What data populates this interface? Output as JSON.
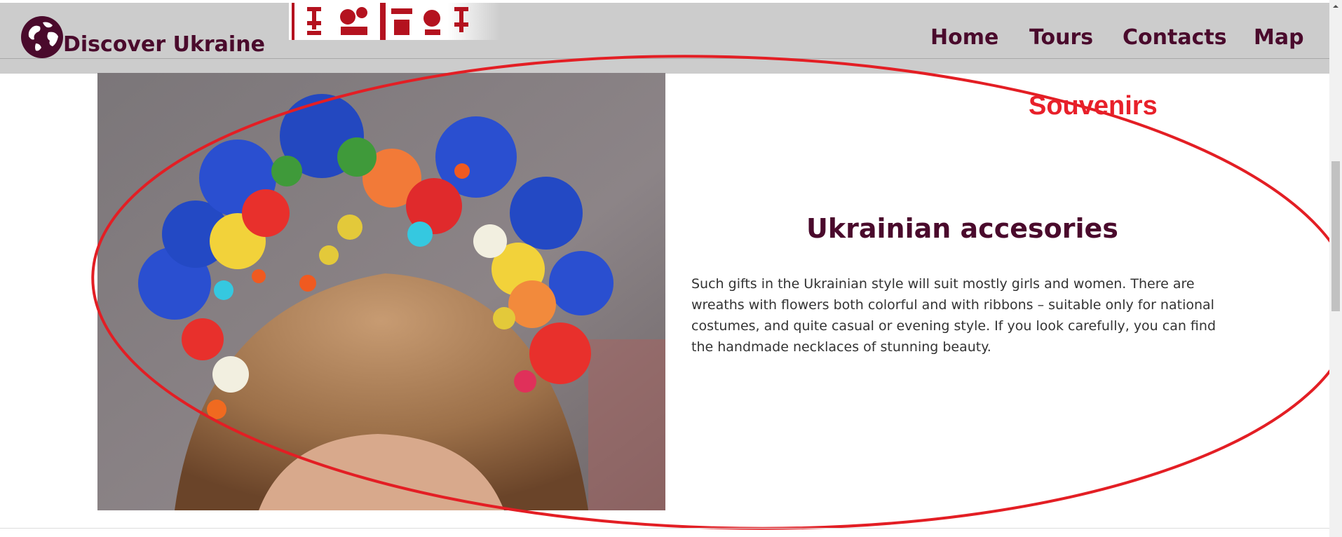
{
  "header": {
    "brand_name": "Discover Ukraine",
    "logo_icon": "globe-icon",
    "nav": [
      {
        "label": "Home"
      },
      {
        "label": "Tours"
      },
      {
        "label": "Contacts"
      },
      {
        "label": "Map"
      }
    ]
  },
  "section": {
    "title": "Souvenirs"
  },
  "card": {
    "title": "Ukrainian accesories",
    "body": "Such gifts in the Ukrainian style will suit mostly girls and women. There are wreaths with flowers both colorful and with ribbons – suitable only for national costumes, and quite casual or evening style. If you look carefully, you can find the handmade necklaces of stunning beauty.",
    "image": "flower-wreath-photo"
  },
  "colors": {
    "nav_background": "#cccccc",
    "brand_text": "#4a0a2c",
    "section_title": "#e8202a",
    "annotation_ellipse": "#e31e24"
  }
}
